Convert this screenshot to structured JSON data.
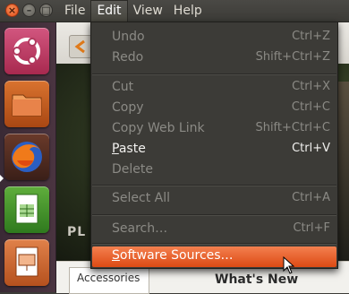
{
  "window_controls": {
    "close": "×",
    "minimize": "–",
    "maximize": "□"
  },
  "menubar": {
    "items": [
      {
        "label": "File"
      },
      {
        "label": "Edit"
      },
      {
        "label": "View"
      },
      {
        "label": "Help"
      }
    ]
  },
  "edit_menu": {
    "undo": {
      "label": "Undo",
      "accel": "Ctrl+Z"
    },
    "redo": {
      "label": "Redo",
      "accel": "Shift+Ctrl+Z"
    },
    "cut": {
      "label": "Cut",
      "accel": "Ctrl+X"
    },
    "copy": {
      "label": "Copy",
      "accel": "Ctrl+C"
    },
    "copy_web_link": {
      "label": "Copy Web Link",
      "accel": "Shift+Ctrl+C"
    },
    "paste_first": "P",
    "paste_rest": "aste",
    "paste_accel": "Ctrl+V",
    "delete": {
      "label": "Delete"
    },
    "select_all": {
      "label": "Select All",
      "accel": "Ctrl+A"
    },
    "search": {
      "label": "Search…",
      "accel": "Ctrl+F"
    },
    "software_sources_first": "S",
    "software_sources_rest": "oftware Sources…"
  },
  "app": {
    "banner_text": "PL",
    "accessories": "Accessories",
    "whats_new": "What's New"
  },
  "colors": {
    "highlight": "#dd4a14",
    "menu_bg": "#3c3b37",
    "disabled_text": "#8b8a85",
    "enabled_text": "#f2f1ef"
  }
}
